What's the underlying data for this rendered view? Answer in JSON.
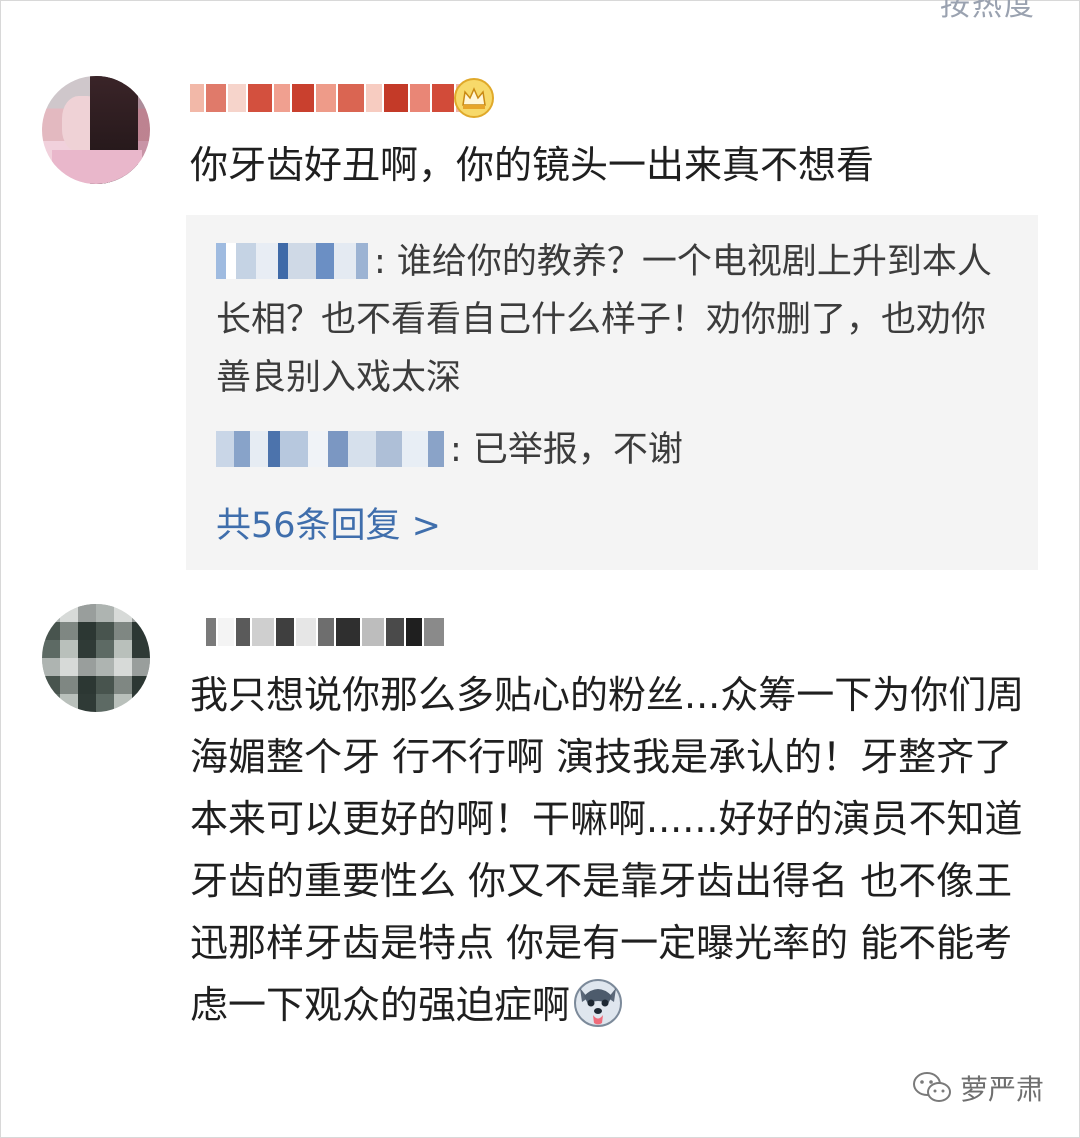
{
  "header": {
    "sort_label": "按热度"
  },
  "comments": [
    {
      "text": "你牙齿好丑啊，你的镜头一出来真不想看",
      "replies": [
        {
          "text": ": 谁给你的教养？一个电视剧上升到本人长相？也不看看自己什么样子！劝你删了，也劝你善良别入戏太深"
        },
        {
          "text": ": 已举报，不谢"
        }
      ],
      "reply_count_label": "共56条回复 >"
    },
    {
      "text": "我只想说你那么多贴心的粉丝...众筹一下为你们周海媚整个牙 行不行啊 演技我是承认的！牙整齐了本来可以更好的啊！干嘛啊......好好的演员不知道牙齿的重要性么 你又不是靠牙齿出得名 也不像王迅那样牙齿是特点 你是有一定曝光率的 能不能考虑一下观众的强迫症啊"
    }
  ],
  "watermark": {
    "label": "萝严肃"
  },
  "colors": {
    "link": "#3f6eac",
    "reply_bg": "#f4f4f4",
    "text": "#1f1f1f"
  },
  "icons": {
    "crown": "crown-icon",
    "emoji": "husky-dog-emoji-icon",
    "watermark": "wechat-icon"
  }
}
